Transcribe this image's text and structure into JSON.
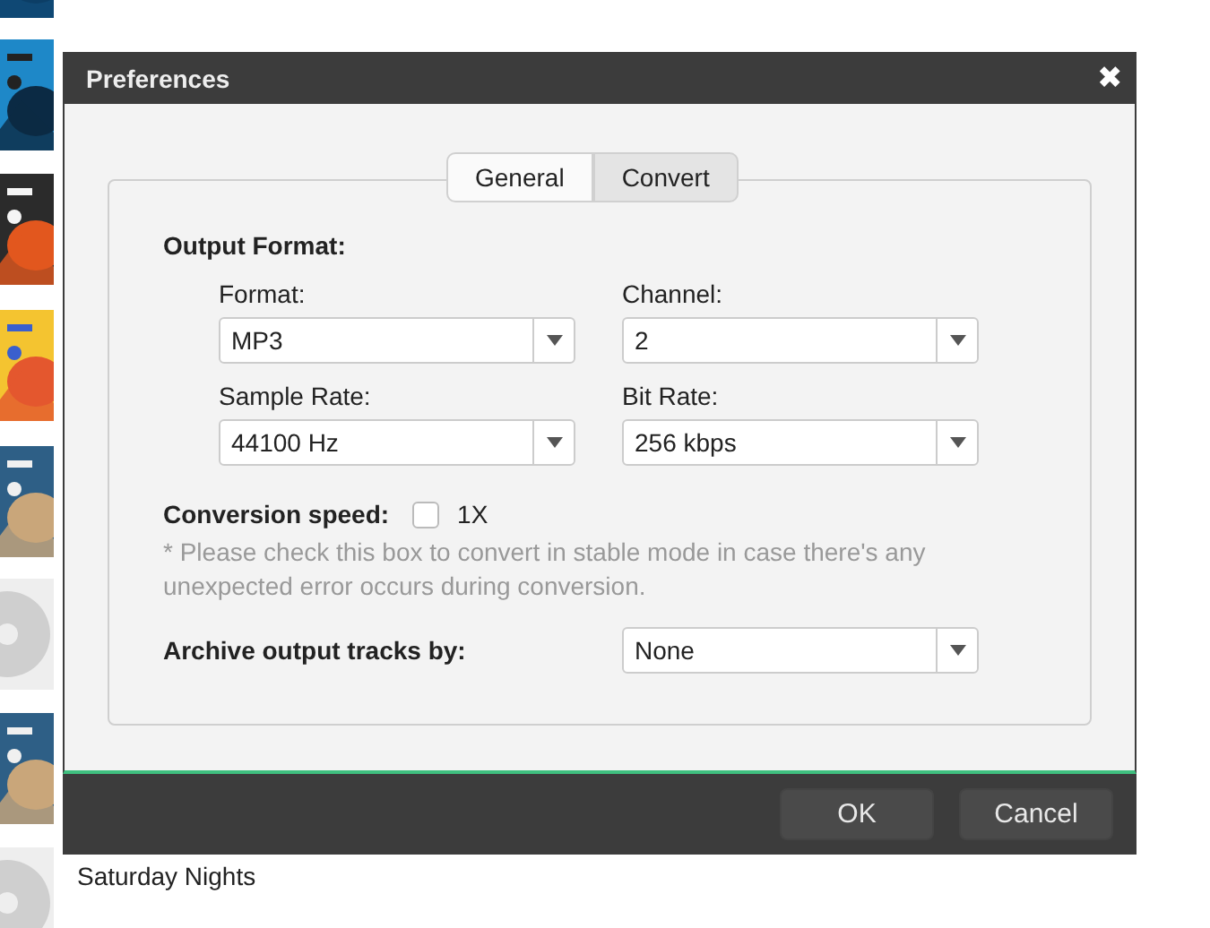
{
  "background_list": {
    "thumbnails": [
      {
        "kind": "picture"
      },
      {
        "kind": "picture"
      },
      {
        "kind": "picture"
      },
      {
        "kind": "picture"
      },
      {
        "kind": "picture"
      },
      {
        "kind": "disc"
      },
      {
        "kind": "picture"
      },
      {
        "kind": "disc"
      }
    ],
    "track_title": "Saturday Nights"
  },
  "dialog": {
    "title": "Preferences",
    "close": "✖",
    "tabs": [
      {
        "label": "General",
        "selected": false
      },
      {
        "label": "Convert",
        "selected": true
      }
    ],
    "section_title": "Output Format:",
    "fields": [
      {
        "label": "Format:",
        "value": "MP3"
      },
      {
        "label": "Channel:",
        "value": "2"
      },
      {
        "label": "Sample Rate:",
        "value": "44100 Hz"
      },
      {
        "label": "Bit Rate:",
        "value": "256 kbps"
      }
    ],
    "conversion_speed": {
      "label": "Conversion speed:",
      "option": "1X",
      "checked": false,
      "note": "* Please check this box to convert in stable mode in case there's any unexpected error occurs during conversion."
    },
    "archive": {
      "label": "Archive output tracks by:",
      "value": "None"
    },
    "buttons": [
      "OK",
      "Cancel"
    ]
  }
}
